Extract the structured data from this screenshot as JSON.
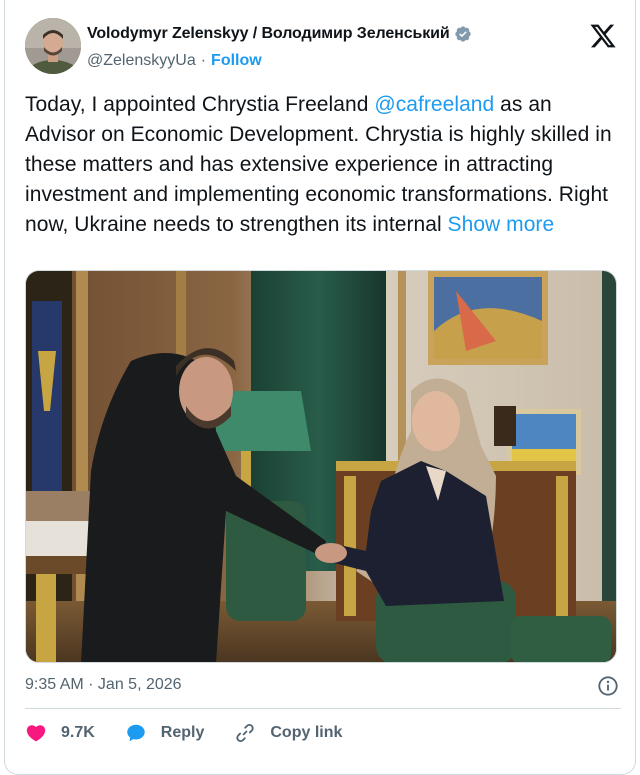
{
  "author": {
    "display_name": "Volodymyr Zelenskyy / Володимир Зеленський",
    "handle": "@ZelenskyyUa",
    "separator": "·",
    "follow_label": "Follow"
  },
  "tweet": {
    "text_before": "Today, I appointed Chrystia Freeland ",
    "mention": "@cafreeland",
    "text_after": " as an Advisor on Economic Development. Chrystia is highly skilled in these matters and has extensive experience in attracting investment and implementing economic transformations. Right now, Ukraine needs to strengthen its internal ",
    "show_more": "Show more"
  },
  "timestamp": "9:35 AM · Jan 5, 2026",
  "actions": {
    "likes": "9.7K",
    "reply": "Reply",
    "copy_link": "Copy link"
  },
  "colors": {
    "accent": "#1d9bf0",
    "like": "#f91880",
    "muted": "#536471",
    "border": "#cfd9de"
  }
}
